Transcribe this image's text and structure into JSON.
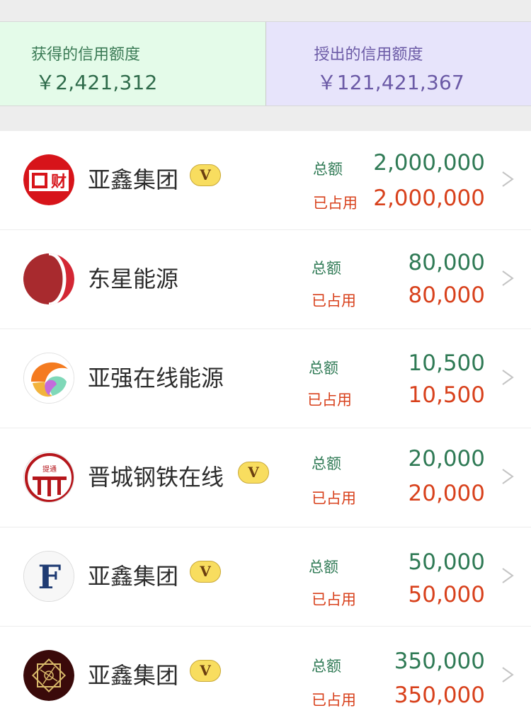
{
  "summary": {
    "received": {
      "title": "获得的信用额度",
      "amount": "￥2,421,312"
    },
    "granted": {
      "title": "授出的信用额度",
      "amount": "￥121,421,367"
    }
  },
  "labels": {
    "total": "总额",
    "used": "已占用"
  },
  "vip_badge": "V",
  "companies": [
    {
      "name": "亚鑫集团",
      "vip": true,
      "logo": "cai-logo-icon",
      "total": "2,000,000",
      "used": "2,000,000"
    },
    {
      "name": "东星能源",
      "vip": false,
      "logo": "red-sphere-logo-icon",
      "total": "80,000",
      "used": "80,000"
    },
    {
      "name": "亚强在线能源",
      "vip": false,
      "logo": "colorful-swirl-logo-icon",
      "total": "10,500",
      "used": "10,500"
    },
    {
      "name": "晋城钢铁在线",
      "vip": true,
      "logo": "red-gate-logo-icon",
      "total": "20,000",
      "used": "20,000"
    },
    {
      "name": "亚鑫集团",
      "vip": true,
      "logo": "letter-f-logo-icon",
      "total": "50,000",
      "used": "50,000"
    },
    {
      "name": "亚鑫集团",
      "vip": true,
      "logo": "gold-frame-logo-icon",
      "total": "350,000",
      "used": "350,000"
    }
  ],
  "logo_texts": {
    "cai": "财",
    "gate": "提通",
    "f": "F"
  },
  "colors": {
    "total_green": "#2f7a55",
    "used_red": "#d8411c",
    "vip_yellow": "#f8dd5f",
    "received_bg": "#e4fbe9",
    "granted_bg": "#e7e4fb"
  }
}
